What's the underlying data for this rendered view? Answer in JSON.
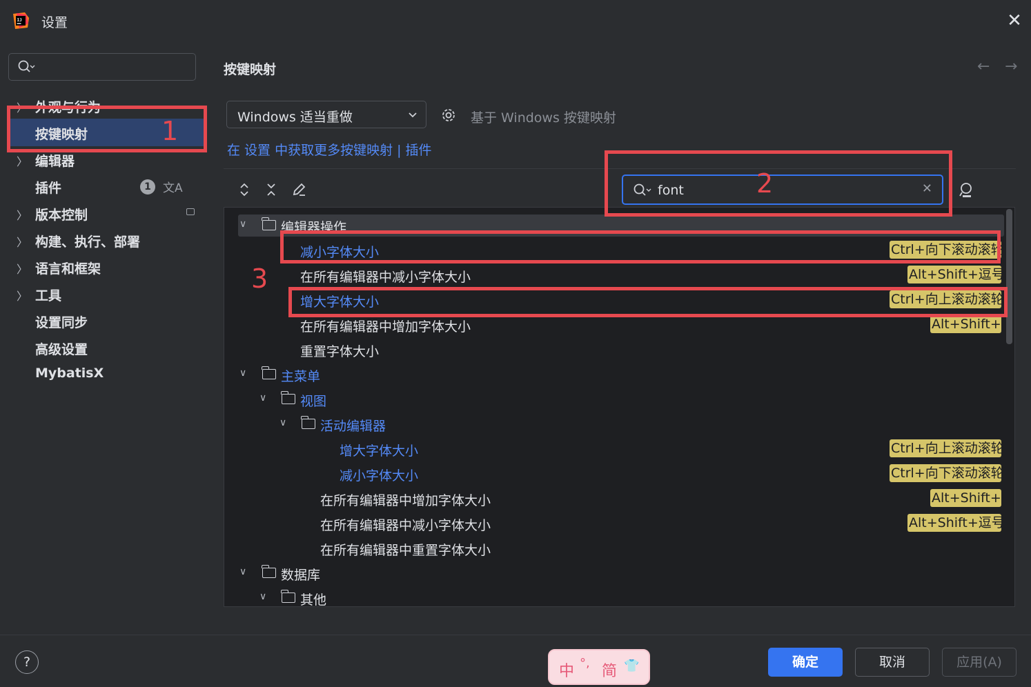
{
  "window": {
    "title": "设置",
    "close_icon": "close-icon"
  },
  "sidebar": {
    "search_placeholder": "",
    "items": [
      {
        "label": "外观与行为",
        "expandable": true
      },
      {
        "label": "按键映射",
        "expandable": false,
        "selected": true
      },
      {
        "label": "编辑器",
        "expandable": true
      },
      {
        "label": "插件",
        "expandable": false,
        "badge": "1"
      },
      {
        "label": "版本控制",
        "expandable": true
      },
      {
        "label": "构建、执行、部署",
        "expandable": true
      },
      {
        "label": "语言和框架",
        "expandable": true
      },
      {
        "label": "工具",
        "expandable": true
      },
      {
        "label": "设置同步",
        "expandable": false
      },
      {
        "label": "高级设置",
        "expandable": false
      },
      {
        "label": "MybatisX",
        "expandable": false
      }
    ]
  },
  "main": {
    "title": "按键映射",
    "keymap_value": "Windows 适当重做",
    "base_note": "基于 Windows 按键映射",
    "more_link": "在 设置 中获取更多按键映射 | 插件",
    "filter_value": "font"
  },
  "tree": [
    {
      "label": "编辑器操作",
      "kind": "folder",
      "style": "plain",
      "expanded": true
    },
    {
      "label": "减小字体大小",
      "kind": "action",
      "style": "link",
      "shortcut": "Ctrl+向下滚动滚轮"
    },
    {
      "label": "在所有编辑器中减小字体大小",
      "kind": "action",
      "style": "plain",
      "shortcut": "Alt+Shift+逗号"
    },
    {
      "label": "增大字体大小",
      "kind": "action",
      "style": "link",
      "shortcut": "Ctrl+向上滚动滚轮"
    },
    {
      "label": "在所有编辑器中增加字体大小",
      "kind": "action",
      "style": "plain",
      "shortcut": "Alt+Shift+."
    },
    {
      "label": "重置字体大小",
      "kind": "action",
      "style": "plain",
      "shortcut": ""
    },
    {
      "label": "主菜单",
      "kind": "folder",
      "style": "link",
      "expanded": true
    },
    {
      "label": "视图",
      "kind": "folder",
      "style": "link",
      "expanded": true
    },
    {
      "label": "活动编辑器",
      "kind": "folder",
      "style": "link",
      "expanded": true
    },
    {
      "label": "增大字体大小",
      "kind": "action",
      "style": "link",
      "shortcut": "Ctrl+向上滚动滚轮"
    },
    {
      "label": "减小字体大小",
      "kind": "action",
      "style": "link",
      "shortcut": "Ctrl+向下滚动滚轮"
    },
    {
      "label": "在所有编辑器中增加字体大小",
      "kind": "action",
      "style": "plain",
      "shortcut": "Alt+Shift+."
    },
    {
      "label": "在所有编辑器中减小字体大小",
      "kind": "action",
      "style": "plain",
      "shortcut": "Alt+Shift+逗号"
    },
    {
      "label": "在所有编辑器中重置字体大小",
      "kind": "action",
      "style": "plain",
      "shortcut": ""
    },
    {
      "label": "数据库",
      "kind": "folder",
      "style": "plain",
      "expanded": true
    },
    {
      "label": "其他",
      "kind": "folder",
      "style": "plain",
      "expanded": true
    }
  ],
  "annotations": [
    "1",
    "2",
    "3"
  ],
  "ime": {
    "chars": [
      "中",
      "°,",
      "简",
      "👕"
    ]
  },
  "footer": {
    "help": "?",
    "ok": "确定",
    "cancel": "取消",
    "apply": "应用(A)"
  },
  "colors": {
    "accent": "#3574f0",
    "link": "#548af7",
    "shortcut_bg": "#d6c569",
    "annotation": "#e6494f",
    "selection": "#2e436e"
  }
}
